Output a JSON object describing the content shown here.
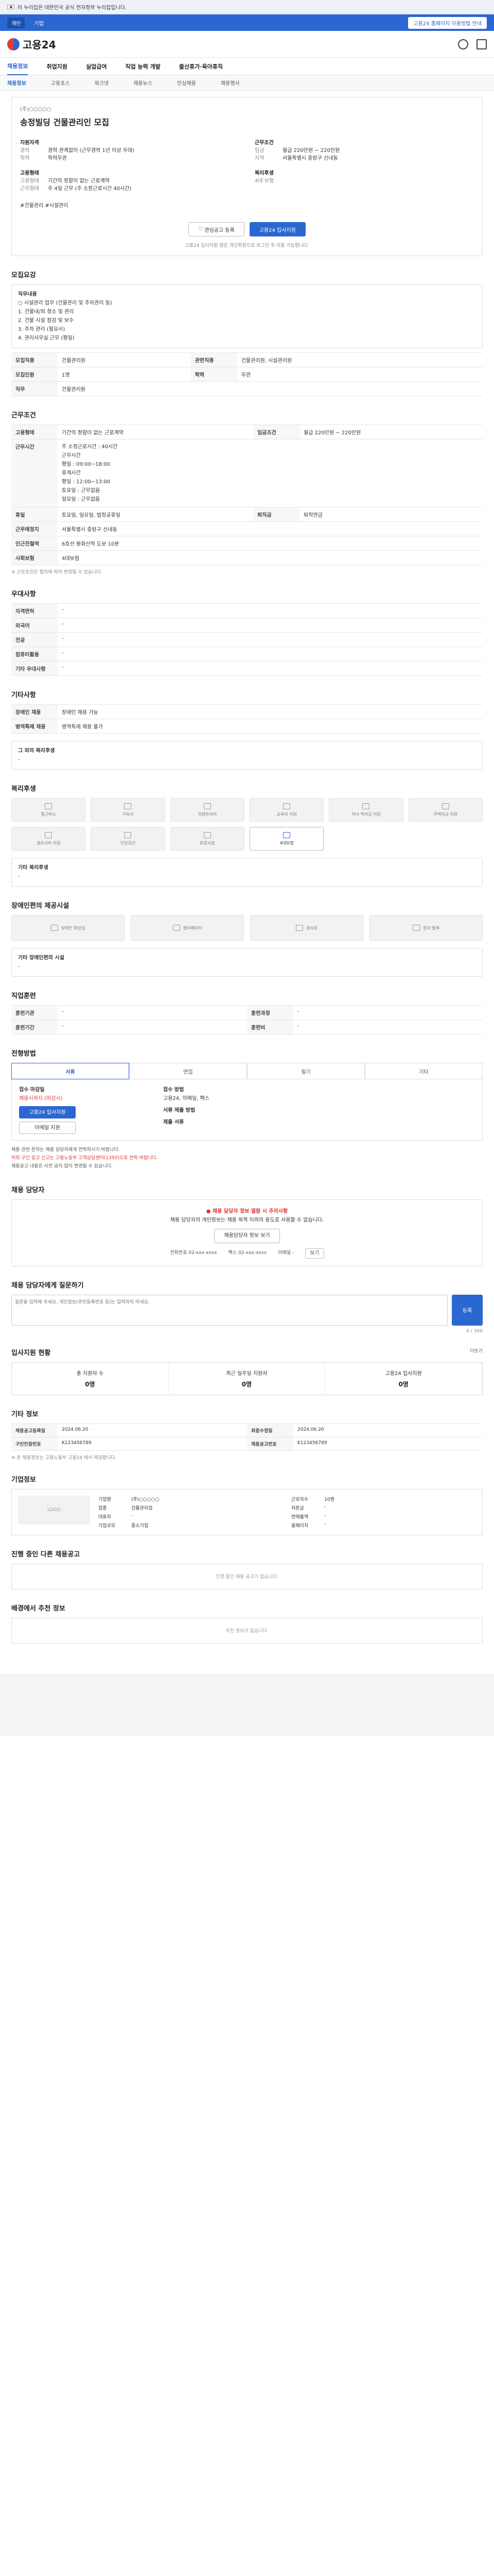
{
  "gov_banner": {
    "text": "이 누리집은 대한민국 공식 전자정부 누리집입니다."
  },
  "util": {
    "left1": "개인",
    "left2": "기업",
    "right": "고용24 홈페이지 이용방법 안내"
  },
  "header": {
    "logo": "고용24"
  },
  "gnb": {
    "items": [
      "채용정보",
      "취업지원",
      "실업급여",
      "직업 능력 개발",
      "출산휴가·육아휴직"
    ]
  },
  "lnb": {
    "items": [
      "채용정보",
      "고용포스",
      "워크넷",
      "채용뉴스",
      "안심채용",
      "채용행사"
    ]
  },
  "job": {
    "company": "(주)○○○○○",
    "title": "송정빌딩 건물관리인 모집",
    "sec1": "지원자격",
    "sec2": "근무조건",
    "rows_left": [
      [
        "경력",
        "경력 관계없이 (근무경력 1년 이상 우대)"
      ],
      [
        "학력",
        "학력무관"
      ]
    ],
    "rows_right": [
      [
        "임금",
        "월급 220만원 ~ 220만원"
      ],
      [
        "지역",
        "서울특별시 중랑구 신내동"
      ]
    ],
    "sec3": "고용형태",
    "sec4": "복리후생",
    "rows_left2": [
      [
        "고용형태",
        "기간의 정함이 없는 근로계약"
      ],
      [
        "근무형태",
        "주 4일 근무 (주 소정근로시간 40시간)"
      ]
    ],
    "rows_right2": [
      [
        "",
        "4대 보험"
      ]
    ],
    "tagline": "#건물관리 #시설관리",
    "btn_save": "관심공고 등록",
    "btn_apply": "고용24 입사지원",
    "notice": "고용24 입사지원 탭은 개인회원으로 로그인 후 이용 가능합니다."
  },
  "duties": {
    "title": "모집요강",
    "box_title": "직무내용",
    "lines": [
      "○ 시설관리 업무 (건물관리 및 주차관리 등)",
      "1. 건물내/외 청소 및 관리",
      "2. 건물 시설 점검 및 보수",
      "3. 주차 관리 (필요시)",
      "4. 관리사무실 근무 (평일)"
    ],
    "rows": [
      [
        "모집직종",
        "건물관리원"
      ],
      [
        "관련직종",
        "건물관리원, 시설관리원"
      ],
      [
        "모집인원",
        "1명"
      ],
      [
        "학력",
        "무관"
      ],
      [
        "직무",
        "건물관리원"
      ]
    ]
  },
  "cond": {
    "title": "근무조건",
    "rows": [
      [
        "고용형태",
        "기간의 정함이 없는 근로계약"
      ],
      [
        "임금조건",
        "월급 220만원 ~ 220만원"
      ]
    ],
    "schedule": [
      "주 소정근로시간 : 40시간",
      "근무시간",
      "평일 : 09:00~18:00",
      "휴게시간",
      "평일 : 12:00~13:00",
      "토요일 : 근무없음",
      "일요일 : 근무없음"
    ],
    "rows2": [
      [
        "휴일",
        "토요일, 일요일, 법정공휴일"
      ],
      [
        "퇴직금",
        "퇴직연금"
      ],
      [
        "근무예정지",
        "서울특별시 중랑구 신내동"
      ],
      [
        "인근전철역",
        "6호선 봉화산역 도보 10분"
      ],
      [
        "사회보험",
        "4대보험"
      ]
    ],
    "note": "※ 근로조건은 협의에 따라 변경될 수 있습니다."
  },
  "welfare": {
    "title": "우대사항",
    "rows": [
      [
        "자격면허",
        "-"
      ],
      [
        "외국어",
        "-"
      ],
      [
        "전공",
        "-"
      ],
      [
        "컴퓨터활용",
        "-"
      ],
      [
        "기타 우대사항",
        "-"
      ]
    ]
  },
  "other": {
    "title": "기타사항",
    "rows": [
      [
        "장애인 채용",
        "장애인 채용 가능"
      ],
      [
        "병역특례 채용",
        "병역특례 채용 불가"
      ]
    ],
    "more_title": "그 외의 복리후생",
    "more_val": "-"
  },
  "benefits": {
    "title": "복리후생",
    "tiles": [
      "통근버스",
      "기숙사",
      "차량유지비",
      "교육비 지원",
      "자녀 학자금 지원",
      "주택자금 지원",
      "경조사비 지원",
      "건강검진",
      "휴양시설",
      "4대보험"
    ],
    "more_title": "기타 복리후생",
    "more_val": "-"
  },
  "disability": {
    "title": "장애인편의 제공시설",
    "tiles": [
      "장애인 화장실",
      "엘리베이터",
      "경사로",
      "점자 블록"
    ],
    "more_title": "기타 장애인편의 시설",
    "more_val": "-"
  },
  "hours": {
    "title": "직업훈련",
    "rows": [
      [
        "훈련기관",
        "-"
      ],
      [
        "훈련과정",
        "-"
      ],
      [
        "훈련기간",
        "-"
      ],
      [
        "훈련비",
        "-"
      ]
    ]
  },
  "method": {
    "title": "전형방법",
    "tabs": [
      "서류",
      "면접",
      "필기",
      "기타"
    ],
    "left": [
      "접수 마감일",
      "채용시까지 (마감시)",
      "고용24 입사지원"
    ],
    "right": [
      "접수 방법",
      "고용24, 이메일, 팩스",
      "서류 제출 방법",
      "제출 서류"
    ],
    "bt1": "고용24 입사지원",
    "bt2": "이메일 지원",
    "bullets": [
      "채용 관련 문의는 채용 담당자에게 연락하시기 바랍니다.",
      "허위 구인 광고 신고는 고용노동부 고객상담센터(1350)으로 연락 바랍니다.",
      "채용공고 내용은 사전 공지 없이 변경될 수 있습니다."
    ]
  },
  "contact": {
    "title": "채용 담당자",
    "warn": "채용 담당자 정보 열람 시 주의사항",
    "text": "채용 담당자의 개인정보는 채용 목적 이외의 용도로 사용할 수 없습니다.",
    "btn": "채용담당자 정보 보기",
    "meta": [
      [
        "전화번호",
        "02-xxx-xxxx"
      ],
      [
        "팩스",
        "02-xxx-xxxx"
      ],
      [
        "이메일",
        "-"
      ]
    ],
    "meta_btn": "보기"
  },
  "qa": {
    "title": "채용 담당자에게 질문하기",
    "placeholder": "질문을 입력해 주세요. 개인정보(주민등록번호 등)는 입력하지 마세요.",
    "btn": "등록",
    "count": "0 / 300"
  },
  "applicants": {
    "title": "입사지원 현황",
    "items": [
      [
        "총 지원자 수",
        "0명"
      ],
      [
        "최근 일주일 지원자",
        "0명"
      ],
      [
        "고용24 입사지원",
        "0명"
      ]
    ],
    "more": "더보기"
  },
  "meta_info": {
    "title": "기타 정보",
    "rows": [
      [
        "채용공고등록일",
        "2024.06.20",
        "최종수정일",
        "2024.06.20"
      ],
      [
        "구인인증번호",
        "K123456789",
        "채용공고번호",
        "K123456789"
      ]
    ],
    "note": "※ 본 채용정보는 고용노동부 고용24 에서 제공합니다."
  },
  "company": {
    "title": "기업정보",
    "logo": "LOGO",
    "rows": [
      [
        "기업명",
        "(주)○○○○○"
      ],
      [
        "업종",
        "건물관리업"
      ],
      [
        "대표자",
        "-"
      ],
      [
        "기업규모",
        "중소기업"
      ]
    ],
    "rows2": [
      [
        "근로자수",
        "10명"
      ],
      [
        "자본금",
        "-"
      ],
      [
        "연매출액",
        "-"
      ],
      [
        "홈페이지",
        "-"
      ]
    ]
  },
  "other_jobs": {
    "title": "진행 중인 다른 채용공고",
    "empty": "진행 중인 채용 공고가 없습니다."
  },
  "recommend": {
    "title": "배경에서 추천 정보",
    "empty": "추천 정보가 없습니다."
  }
}
